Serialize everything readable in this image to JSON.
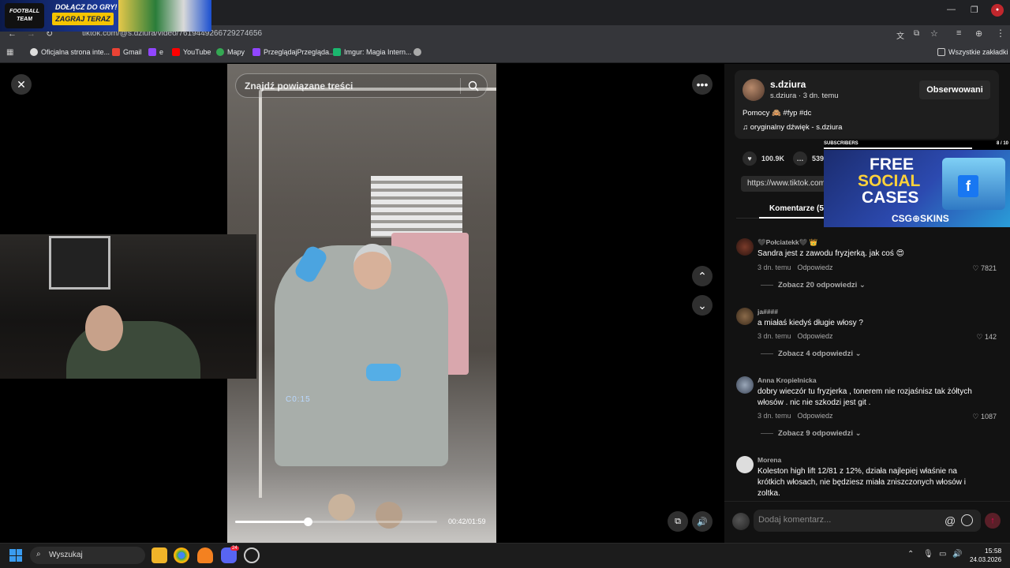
{
  "browser": {
    "url": "tiktok.com/@s.dziura/video/7619449266729274656",
    "bookmarks": [
      "Oficjalna strona inte...",
      "Gmail",
      "e",
      "YouTube",
      "Mapy",
      "PrzeglądajPrzegląda...",
      "Imgur: Magia Intern..."
    ],
    "all_bookmarks": "Wszystkie zakładki"
  },
  "ad_banner": {
    "logo": "FOOTBALL TEAM",
    "title": "DOŁĄCZ DO GRY!",
    "cta": "ZAGRAJ TERAZ"
  },
  "video": {
    "search_placeholder": "Znajdź powiązane treści",
    "current_time": "00:42/01:59",
    "progress": 0.36,
    "mirror_clock": "C0:15"
  },
  "post": {
    "username": "s.dziura",
    "subline": "s.dziura · 3 dn. temu",
    "follow_label": "Obserwowani",
    "description": "Pomocy 🙈 #fyp #dc",
    "sound": "oryginalny dźwięk - s.dziura",
    "likes": "100.9K",
    "comments_count": "539",
    "link": "https://www.tiktok.com",
    "comments_tab": "Komentarze (53"
  },
  "csg_ad": {
    "label": "SUBSCRIBERS",
    "count": "8 / 10",
    "line1": "FREE",
    "line2": "SOCIAL",
    "line3": "CASES",
    "brand": "CSG⊕SKINS"
  },
  "comments": [
    {
      "name": "🖤Połciatekk🖤 👑",
      "text": "Sandra jest z zawodu fryzjerką. jak coś 😍",
      "time": "3 dn. temu",
      "reply": "Odpowiedz",
      "likes": "7821",
      "more": "Zobacz 20 odpowiedzi ⌄"
    },
    {
      "name": "ja####",
      "text": "a miałaś kiedyś długie włosy ?",
      "time": "3 dn. temu",
      "reply": "Odpowiedz",
      "likes": "142",
      "more": "Zobacz 4 odpowiedzi ⌄"
    },
    {
      "name": "Anna Kropielnicka",
      "text": "dobry wieczór tu fryzjerka , tonerem nie rozjaśnisz tak żółtych włosów . nic nie szkodzi jest git .",
      "time": "3 dn. temu",
      "reply": "Odpowiedz",
      "likes": "1087",
      "more": "Zobacz 9 odpowiedzi ⌄"
    },
    {
      "name": "Morena",
      "text": "Koleston high lift 12/81 z 12%, działa najlepiej właśnie na krótkich włosach, nie będziesz miała zniszczonych włosów i zoltka.",
      "time": "",
      "reply": "",
      "likes": "",
      "more": ""
    }
  ],
  "comment_input_placeholder": "Dodaj komentarz...",
  "taskbar": {
    "search_placeholder": "Wyszukaj",
    "time": "15:58",
    "date": "24.03.2026",
    "discord_badge": "24"
  }
}
